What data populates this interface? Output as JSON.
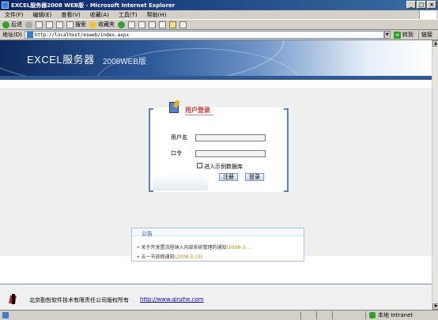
{
  "window": {
    "title": "EXCEL服务器2008 WEB版 - Microsoft Internet Explorer",
    "minimize": "_",
    "maximize": "□",
    "close": "×"
  },
  "menu": [
    "文件(F)",
    "编辑(E)",
    "查看(V)",
    "收藏(A)",
    "工具(T)",
    "帮助(H)"
  ],
  "toolbar": {
    "back": "后退",
    "search": "搜索",
    "favorites": "收藏夹"
  },
  "address": {
    "label": "地址(D)",
    "url": "http://localhost/esweb/index.aspx",
    "go": "转到",
    "links": "链接"
  },
  "banner": {
    "title": "EXCEL服务器",
    "subtitle": "2008WEB版"
  },
  "login": {
    "title": "用户登录",
    "username_label": "用户名",
    "password_label": "口令",
    "sample_db_label": "进入示例数据库",
    "register_button": "注册",
    "login_button": "登录"
  },
  "notice": {
    "title": "公告",
    "items": [
      {
        "text": "关于开发置流程纳入内部系统管理的通知",
        "date": "(2008-3-..."
      },
      {
        "text": "五一节放假通知",
        "date": "(2008-3-13)"
      }
    ]
  },
  "footer": {
    "copyright": "北京勤哲软件技术有限责任公司版权所有",
    "link": "http://www.qinzhe.com"
  },
  "status": {
    "zone": "本地 Intranet"
  },
  "colors": {
    "title_bar": "#0a246a",
    "banner_dark": "#0f2a5e",
    "accent_blue": "#5b7fc4",
    "login_title_red": "#cc3333",
    "link_blue": "#0000cc"
  }
}
